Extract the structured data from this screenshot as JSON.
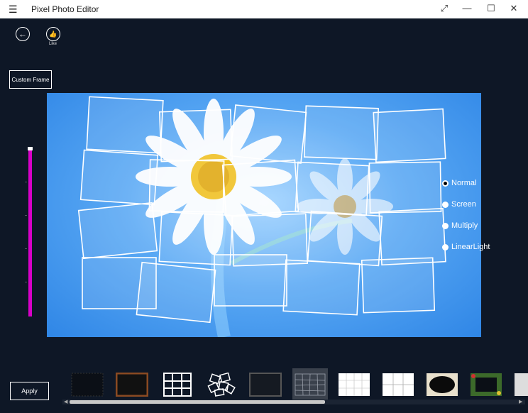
{
  "window": {
    "title": "Pixel Photo Editor",
    "menu_icon": "hamburger-icon",
    "controls": [
      "fullscreen-icon",
      "minimize-icon",
      "maximize-icon",
      "close-icon"
    ],
    "glyphs": {
      "menu": "☰",
      "fullscreen": "⤢",
      "minimize": "—",
      "maximize": "☐",
      "close": "✕"
    }
  },
  "toolbar": {
    "back_icon": "back-arrow-icon",
    "back_glyph": "←",
    "like_icon": "thumbs-up-icon",
    "like_glyph": "👍",
    "like_label": "Like"
  },
  "custom_frame_label": "Custom Frame",
  "apply_label": "Apply",
  "slider": {
    "value": 1.0
  },
  "blend_modes": {
    "options": [
      "Normal",
      "Screen",
      "Multiply",
      "LinearLight"
    ],
    "selected": "Normal"
  },
  "frames_strip": {
    "items": [
      "frame-none",
      "frame-wood",
      "frame-grid",
      "frame-scattered",
      "frame-dark",
      "frame-cells",
      "frame-puzzle",
      "frame-tiles",
      "frame-ornate-black",
      "frame-floral",
      "frame-partial"
    ],
    "selected_index": 5
  },
  "colors": {
    "accent": "#d800c8",
    "background": "#0e1726",
    "canvas": "#4a9cf0"
  }
}
